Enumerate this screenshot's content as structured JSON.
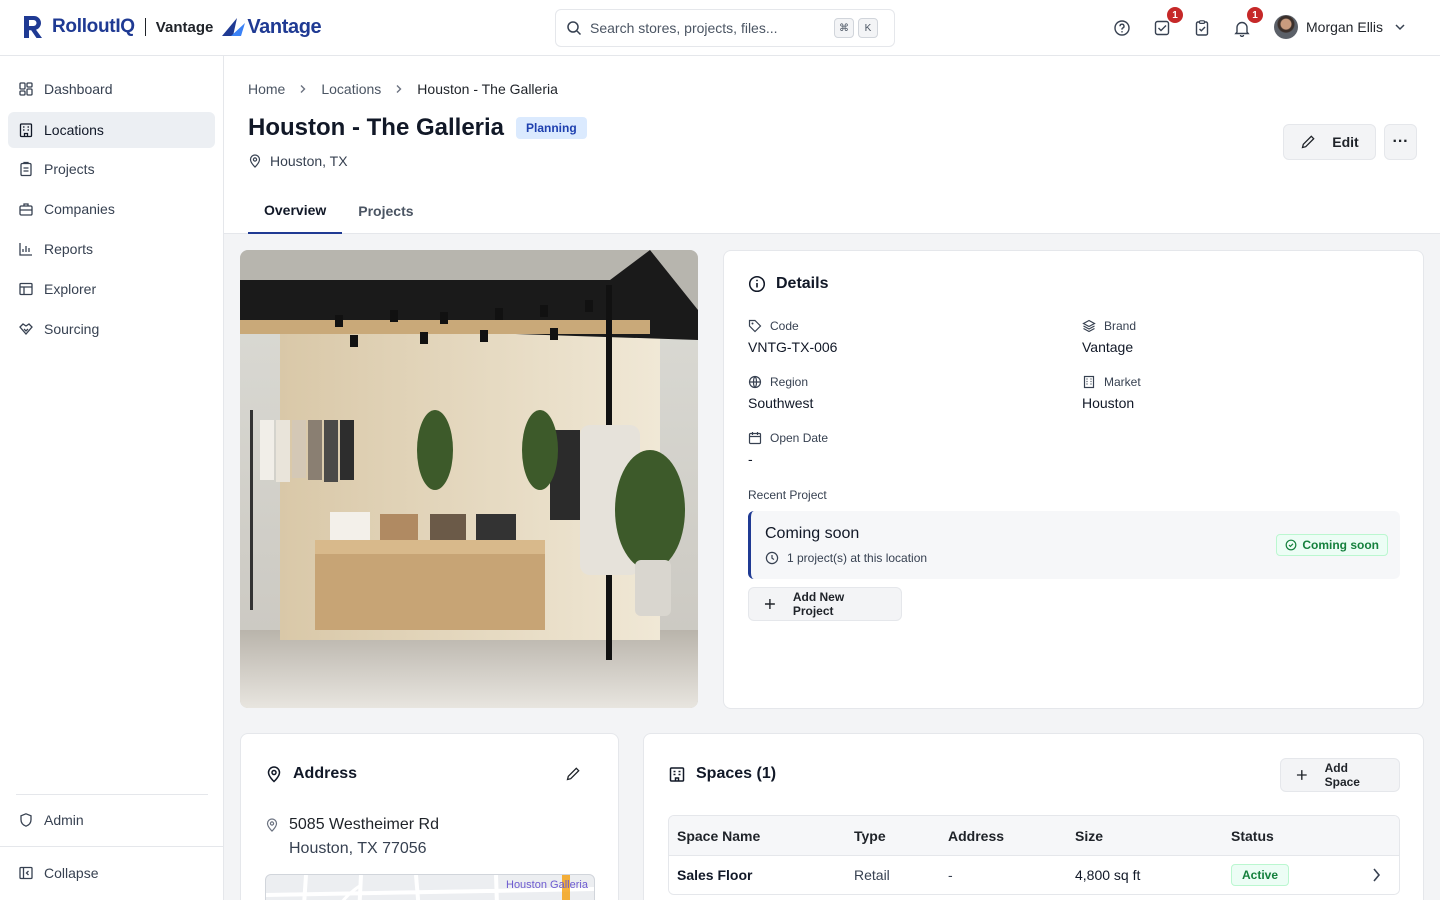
{
  "app": {
    "brand_name": "RolloutIQ",
    "client_name": "Vantage",
    "client_logo_text": "Vantage"
  },
  "search": {
    "placeholder": "Search stores, projects, files...",
    "shortcut_mod": "⌘",
    "shortcut_key": "K"
  },
  "topbar": {
    "tasks_badge": "1",
    "notifications_badge": "1",
    "user_name": "Morgan Ellis"
  },
  "sidebar": {
    "items": [
      {
        "label": "Dashboard",
        "icon": "dashboard-icon"
      },
      {
        "label": "Locations",
        "icon": "building-icon",
        "active": true
      },
      {
        "label": "Projects",
        "icon": "clipboard-icon"
      },
      {
        "label": "Companies",
        "icon": "briefcase-icon"
      },
      {
        "label": "Reports",
        "icon": "bar-chart-icon"
      },
      {
        "label": "Explorer",
        "icon": "table-icon"
      },
      {
        "label": "Sourcing",
        "icon": "handshake-icon"
      }
    ],
    "admin_label": "Admin",
    "collapse_label": "Collapse"
  },
  "breadcrumb": [
    "Home",
    "Locations",
    "Houston - The Galleria"
  ],
  "page": {
    "title": "Houston - The Galleria",
    "status_badge": "Planning",
    "location": "Houston, TX",
    "edit_label": "Edit",
    "more_label": "···"
  },
  "tabs": [
    "Overview",
    "Projects"
  ],
  "details": {
    "title": "Details",
    "fields": {
      "code": {
        "label": "Code",
        "value": "VNTG-TX-006"
      },
      "brand": {
        "label": "Brand",
        "value": "Vantage"
      },
      "region": {
        "label": "Region",
        "value": "Southwest"
      },
      "market": {
        "label": "Market",
        "value": "Houston"
      },
      "open_date": {
        "label": "Open Date",
        "value": "-"
      }
    },
    "recent_label": "Recent Project",
    "recent_title": "Coming soon",
    "recent_sub": "1 project(s) at this location",
    "recent_badge": "Coming soon",
    "add_project_label": "Add New Project"
  },
  "address": {
    "title": "Address",
    "line1": "5085 Westheimer Rd",
    "line2": "Houston, TX 77056",
    "map_label": "Houston Galleria"
  },
  "spaces": {
    "title": "Spaces (1)",
    "add_label": "Add Space",
    "columns": [
      "Space Name",
      "Type",
      "Address",
      "Size",
      "Status"
    ],
    "rows": [
      {
        "name": "Sales Floor",
        "type": "Retail",
        "address": "-",
        "size": "4,800 sq ft",
        "status": "Active"
      }
    ]
  },
  "colors": {
    "brand": "#1f3a93",
    "planning_bg": "#dbeafe",
    "active_green": "#15803d",
    "badge_red": "#c62828"
  }
}
